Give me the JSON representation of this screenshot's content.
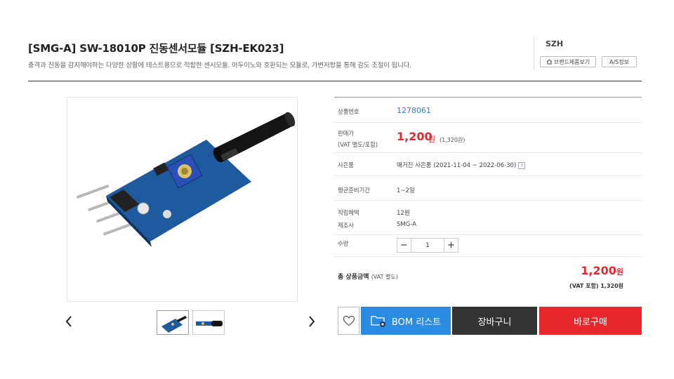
{
  "product": {
    "title": "[SMG-A] SW-18010P 진동센서모듈 [SZH-EK023]",
    "description": "충격과 진동을 감지해야하는 다양한 상황에 테스트용으로 적합한 센서모듈. 아두이노와 호환되는 모듈로, 가변저항을 통해 감도 조절이 됩니다."
  },
  "brand": {
    "name": "SZH",
    "brand_products_label": "브랜드제품보기",
    "as_info_label": "A/S정보"
  },
  "gallery": {
    "prev_icon": "chevron-left-icon",
    "next_icon": "chevron-right-icon"
  },
  "info": {
    "code_label": "상품번호",
    "code_value": "1278061",
    "price_label_1": "판매가",
    "price_label_2": "(VAT 별도/포함)",
    "price_value": "1,200",
    "price_unit": "원",
    "price_vat": "(1,320원)",
    "status_label": "사은품",
    "status_value": "매거진 사은품 (2021-11-04 ~ 2022-06-30)",
    "help_icon": "?",
    "lead_label": "평균준비기간",
    "lead_value": "1~2일",
    "points_label": "적립혜택",
    "points_value": "12원",
    "maker_label": "제조사",
    "maker_value": "SMG-A",
    "qty_label": "수량",
    "qty_value": "1",
    "qty_minus": "−",
    "qty_plus": "+"
  },
  "total": {
    "label": "총 상품금액",
    "label_note": "(VAT 별도)",
    "value": "1,200",
    "unit": "원",
    "vat": "(VAT 포함) 1,320원"
  },
  "actions": {
    "wishlist_icon": "heart-icon",
    "bom_label": "BOM 리스트",
    "cart_label": "장바구니",
    "buy_label": "바로구매"
  },
  "colors": {
    "accent_red": "#e8272d",
    "accent_blue": "#2b8be0",
    "dark": "#333333",
    "link_blue": "#3a7bc8"
  }
}
